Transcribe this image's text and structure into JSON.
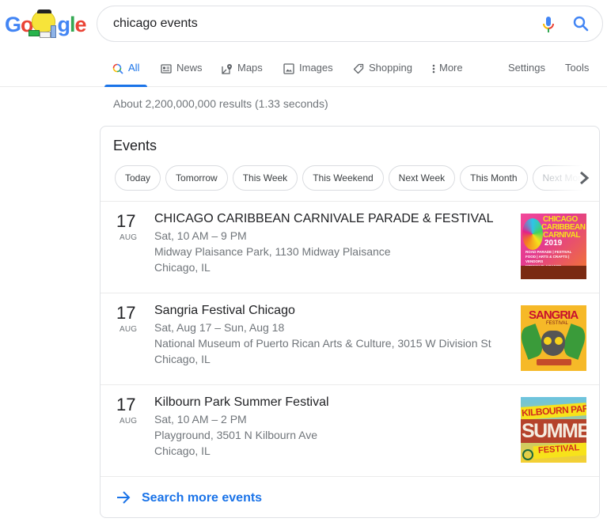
{
  "logo": {
    "text": "Google",
    "alt": "Google doodle"
  },
  "search": {
    "query": "chicago events",
    "placeholder": ""
  },
  "nav": {
    "tabs": [
      {
        "label": "All",
        "icon": "search-icon",
        "active": true
      },
      {
        "label": "News",
        "icon": "news-icon"
      },
      {
        "label": "Maps",
        "icon": "map-pin-icon"
      },
      {
        "label": "Images",
        "icon": "image-icon"
      },
      {
        "label": "Shopping",
        "icon": "tag-icon"
      },
      {
        "label": "More",
        "icon": "more-vert-icon"
      }
    ],
    "settings": "Settings",
    "tools": "Tools"
  },
  "results_stats": "About 2,200,000,000 results (1.33 seconds)",
  "events": {
    "title": "Events",
    "chips": [
      "Today",
      "Tomorrow",
      "This Week",
      "This Weekend",
      "Next Week",
      "This Month",
      "Next Month"
    ],
    "items": [
      {
        "day": "17",
        "month": "AUG",
        "title": "CHICAGO CARIBBEAN CARNIVALE PARADE & FESTIVAL",
        "when": "Sat, 10 AM – 9 PM",
        "venue": "Midway Plaisance Park, 1130 Midway Plaisance",
        "city": "Chicago, IL",
        "thumb": {
          "line1": "CHICAGO",
          "line2": "CARIBBEAN",
          "line3": "CARNIVAL",
          "year": "2019",
          "sub1": "ROAD PARADE | FESTIVAL",
          "sub2": "FOOD | ARTS & CRAFTS | VENDORS",
          "sub3": "MIDWAY PLAISANCE"
        }
      },
      {
        "day": "17",
        "month": "AUG",
        "title": "Sangria Festival Chicago",
        "when": "Sat, Aug 17 – Sun, Aug 18",
        "venue": "National Museum of Puerto Rican Arts & Culture, 3015 W Division St",
        "city": "Chicago, IL",
        "thumb": {
          "line1": "SANGRIA",
          "line2": "FESTIVAL"
        }
      },
      {
        "day": "17",
        "month": "AUG",
        "title": "Kilbourn Park Summer Festival",
        "when": "Sat, 10 AM – 2 PM",
        "venue": "Playground, 3501 N Kilbourn Ave",
        "city": "Chicago, IL",
        "thumb": {
          "line1": "KILBOURN PARK",
          "line2": "SUMMER",
          "line3": "FESTIVAL"
        }
      }
    ],
    "more_label": "Search more events"
  },
  "colors": {
    "accent": "#1a73e8",
    "text_primary": "#202124",
    "text_secondary": "#70757a",
    "border": "#dfe1e5"
  }
}
